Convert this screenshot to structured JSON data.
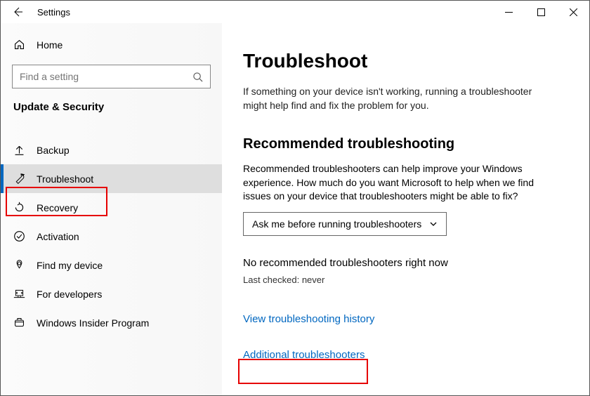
{
  "window": {
    "title": "Settings"
  },
  "sidebar": {
    "home_label": "Home",
    "search_placeholder": "Find a setting",
    "category": "Update & Security",
    "items": [
      {
        "label": "Backup"
      },
      {
        "label": "Troubleshoot"
      },
      {
        "label": "Recovery"
      },
      {
        "label": "Activation"
      },
      {
        "label": "Find my device"
      },
      {
        "label": "For developers"
      },
      {
        "label": "Windows Insider Program"
      }
    ]
  },
  "main": {
    "title": "Troubleshoot",
    "description": "If something on your device isn't working, running a troubleshooter might help find and fix the problem for you.",
    "section_title": "Recommended troubleshooting",
    "section_desc": "Recommended troubleshooters can help improve your Windows experience. How much do you want Microsoft to help when we find issues on your device that troubleshooters might be able to fix?",
    "dropdown_value": "Ask me before running troubleshooters",
    "status": "No recommended troubleshooters right now",
    "last_checked": "Last checked: never",
    "link_history": "View troubleshooting history",
    "link_additional": "Additional troubleshooters"
  }
}
